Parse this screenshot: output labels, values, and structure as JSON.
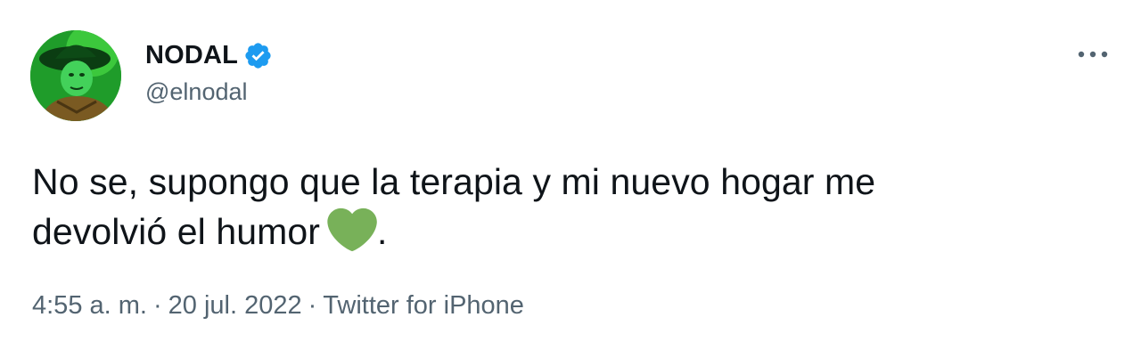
{
  "tweet": {
    "author": {
      "display_name": "NODAL",
      "handle": "@elnodal",
      "verified": true,
      "avatar_icon": "profile-avatar"
    },
    "text_line1": "No se, supongo que la terapia y mi nuevo hogar me",
    "text_line2": "devolvió el humor",
    "text_end": ".",
    "emoji": "green-heart",
    "time": "4:55 a. m.",
    "separator": "·",
    "date": "20 jul. 2022",
    "source": "Twitter for iPhone"
  },
  "colors": {
    "text": "#0f1419",
    "secondary_text": "#536471",
    "verified_badge": "#1d9bf0",
    "emoji_green": "#78b159"
  }
}
